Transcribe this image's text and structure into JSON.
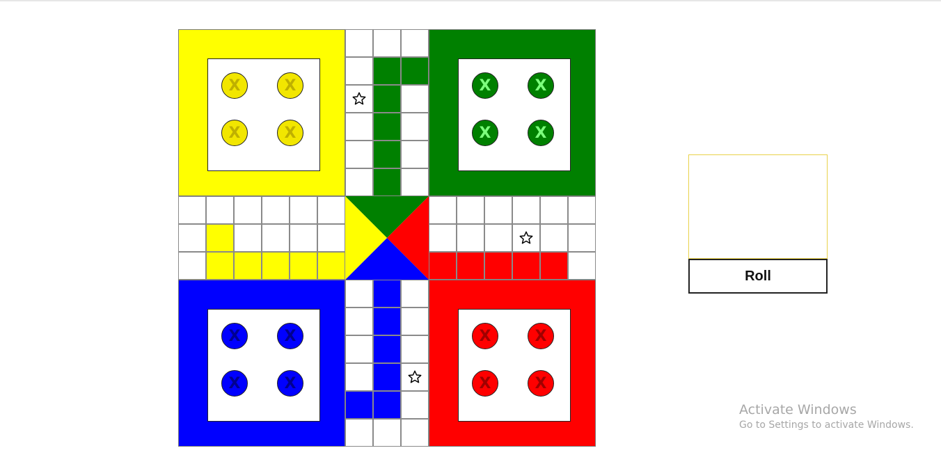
{
  "board": {
    "bases": [
      {
        "color_name": "yellow",
        "color": "#ffff00",
        "token_color": "#f2e600",
        "mark_color": "#bfb000",
        "tokens": [
          "X",
          "X",
          "X",
          "X"
        ]
      },
      {
        "color_name": "green",
        "color": "#008000",
        "token_color": "#008000",
        "mark_color": "#7dff7d",
        "tokens": [
          "X",
          "X",
          "X",
          "X"
        ]
      },
      {
        "color_name": "blue",
        "color": "#0000ff",
        "token_color": "#0000ff",
        "mark_color": "#000090",
        "tokens": [
          "X",
          "X",
          "X",
          "X"
        ]
      },
      {
        "color_name": "red",
        "color": "#ff0000",
        "token_color": "#ff0000",
        "mark_color": "#a00000",
        "tokens": [
          "X",
          "X",
          "X",
          "X"
        ]
      }
    ],
    "center_triangles": [
      {
        "side": "top",
        "color": "#008000"
      },
      {
        "side": "right",
        "color": "#ff0000"
      },
      {
        "side": "bottom",
        "color": "#0000ff"
      },
      {
        "side": "left",
        "color": "#ffff00"
      }
    ],
    "safe_star_icon": "star-outline-icon"
  },
  "dice": {
    "value": ""
  },
  "roll_button": {
    "label": "Roll"
  },
  "watermark": {
    "title": "Activate Windows",
    "subtitle": "Go to Settings to activate Windows."
  }
}
